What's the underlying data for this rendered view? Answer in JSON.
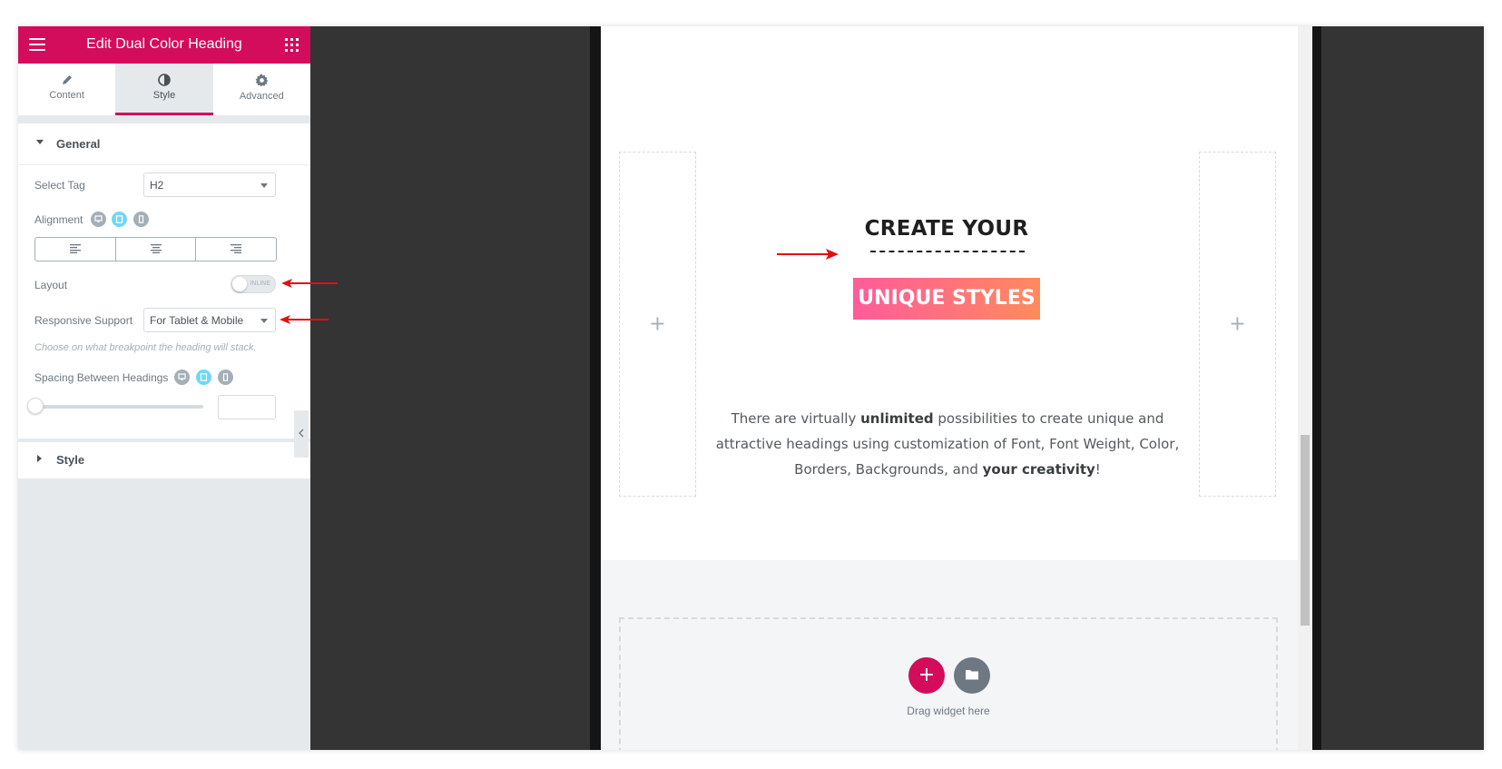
{
  "panel": {
    "title": "Edit Dual Color Heading",
    "tabs": [
      {
        "label": "Content",
        "icon": "pencil-icon"
      },
      {
        "label": "Style",
        "icon": "contrast-icon"
      },
      {
        "label": "Advanced",
        "icon": "gear-icon"
      }
    ],
    "active_tab": "Style",
    "accent_color": "#d30c5c",
    "general": {
      "title": "General",
      "select_tag_label": "Select Tag",
      "select_tag_value": "H2",
      "alignment_label": "Alignment",
      "layout_label": "Layout",
      "layout_toggle_text": "INLINE",
      "responsive_label": "Responsive Support",
      "responsive_value": "For Tablet & Mobile",
      "responsive_hint": "Choose on what breakpoint the heading will stack.",
      "spacing_label": "Spacing Between Headings",
      "spacing_value": ""
    },
    "style_section_title": "Style"
  },
  "preview": {
    "heading_first": "CREATE YOUR",
    "heading_second": "UNIQUE STYLES",
    "para_1": "There are virtually ",
    "para_bold_1": "unlimited",
    "para_2": " possibilities to create unique and attractive headings using customization of Font, Font Weight, Color, Borders, Backgrounds, and ",
    "para_bold_2": "your creativity",
    "para_3": "!",
    "plus": "+",
    "drag_widget_text": "Drag widget here",
    "gradient_colors": [
      "#ff5b9a",
      "#ff8a5e"
    ]
  }
}
